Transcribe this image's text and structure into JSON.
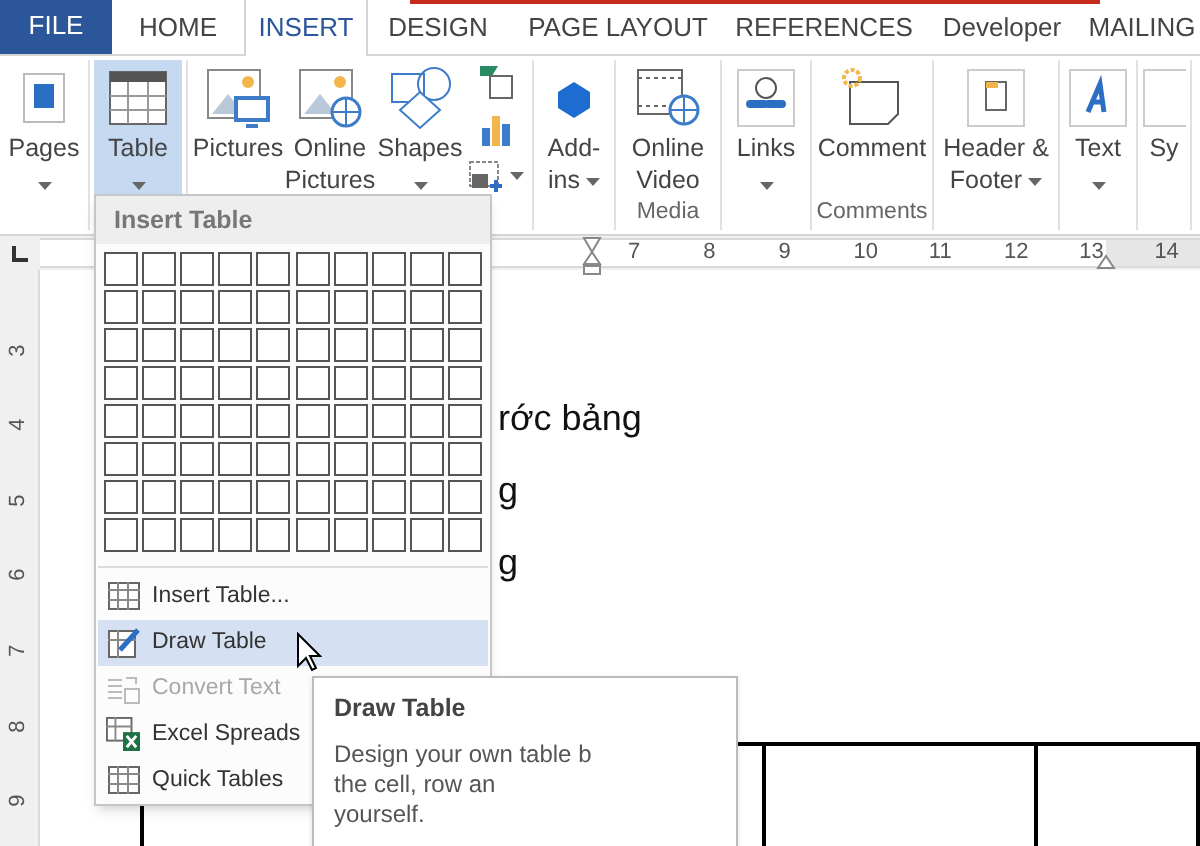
{
  "tabs": [
    {
      "label": "FILE",
      "kind": "file",
      "selected": false
    },
    {
      "label": "HOME",
      "kind": "tab",
      "selected": false
    },
    {
      "label": "INSERT",
      "kind": "tab",
      "selected": true
    },
    {
      "label": "DESIGN",
      "kind": "tab",
      "selected": false
    },
    {
      "label": "PAGE LAYOUT",
      "kind": "tab",
      "selected": false
    },
    {
      "label": "REFERENCES",
      "kind": "tab",
      "selected": false
    },
    {
      "label": "Developer",
      "kind": "tab",
      "selected": false
    },
    {
      "label": "MAILING",
      "kind": "tab",
      "selected": false
    }
  ],
  "ribbon": {
    "groups": [
      {
        "buttons": [
          {
            "label": "Pages",
            "dropdown": true,
            "selected": false
          }
        ]
      },
      {
        "buttons": [
          {
            "label": "Table",
            "dropdown": true,
            "selected": true
          }
        ]
      },
      {
        "buttons": [
          {
            "label": "Pictures",
            "dropdown": false,
            "selected": false
          },
          {
            "label": "Online\nPictures",
            "dropdown": false,
            "selected": false
          },
          {
            "label": "Shapes",
            "dropdown": true,
            "selected": false
          },
          {
            "kind": "stack",
            "dropdown": true
          }
        ]
      },
      {
        "buttons": [
          {
            "label": "Add-\nins",
            "dropdown": true,
            "selected": false
          }
        ]
      },
      {
        "label": "Media",
        "buttons": [
          {
            "label": "Online\nVideo",
            "dropdown": false,
            "selected": false
          }
        ]
      },
      {
        "buttons": [
          {
            "label": "Links",
            "dropdown": true,
            "selected": false
          }
        ]
      },
      {
        "label": "Comments",
        "buttons": [
          {
            "label": "Comment",
            "dropdown": false,
            "selected": false
          }
        ]
      },
      {
        "buttons": [
          {
            "label": "Header &\nFooter",
            "dropdown": true,
            "selected": false
          }
        ]
      },
      {
        "buttons": [
          {
            "label": "Text",
            "dropdown": true,
            "selected": false
          }
        ]
      },
      {
        "buttons": [
          {
            "label": "Sy",
            "dropdown": false,
            "selected": false
          }
        ]
      }
    ]
  },
  "ruler": {
    "horizontal": [
      "7",
      "8",
      "9",
      "10",
      "11",
      "12",
      "13",
      "14"
    ],
    "vertical": [
      "3",
      "4",
      "5",
      "6",
      "7",
      "8",
      "9"
    ]
  },
  "document": {
    "lines": [
      "rớc bảng",
      "g",
      "g"
    ]
  },
  "table_menu": {
    "title": "Insert Table",
    "items": [
      {
        "label": "Insert Table...",
        "selected": false,
        "disabled": false
      },
      {
        "label": "Draw Table",
        "selected": true,
        "disabled": false
      },
      {
        "label": "Convert Text",
        "selected": false,
        "disabled": true
      },
      {
        "label": "Excel Spreads",
        "selected": false,
        "disabled": false
      },
      {
        "label": "Quick Tables",
        "selected": false,
        "disabled": false
      }
    ]
  },
  "tooltip": {
    "title": "Draw Table",
    "lines": [
      "Design your own table b",
      "the cell, row an",
      "yourself."
    ]
  }
}
